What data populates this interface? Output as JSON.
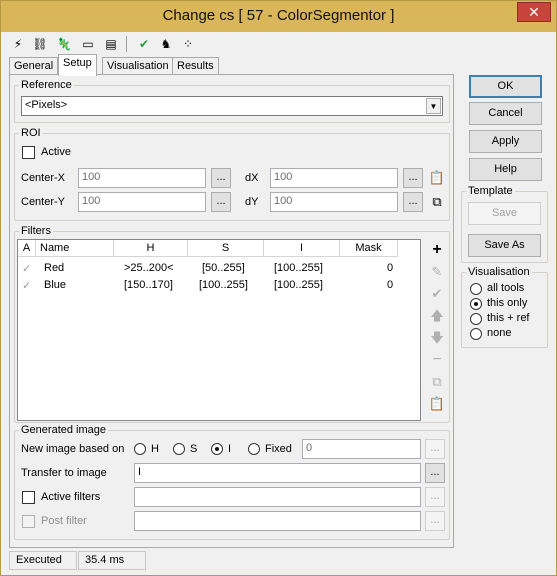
{
  "window": {
    "title": "Change cs [ 57 - ColorSegmentor ]",
    "close_label": "✕"
  },
  "toolbar": {
    "icons": [
      "lightning-icon",
      "link-icon",
      "dinosaur-icon",
      "console-icon",
      "document-icon",
      "checkmark-icon",
      "figure-icon",
      "dots-icon"
    ]
  },
  "tabs": [
    "General",
    "Setup",
    "Visualisation",
    "Results"
  ],
  "reference": {
    "legend": "Reference",
    "value": "<Pixels>"
  },
  "roi": {
    "legend": "ROI",
    "active_label": "Active",
    "center_x_label": "Center-X",
    "center_x": "100",
    "center_y_label": "Center-Y",
    "center_y": "100",
    "dx_label": "dX",
    "dx": "100",
    "dy_label": "dY",
    "dy": "100",
    "dots": "..."
  },
  "filters": {
    "legend": "Filters",
    "columns": [
      "A",
      "Name",
      "H",
      "S",
      "I",
      "Mask"
    ],
    "rows": [
      {
        "name": "Red",
        "h": ">25..200<",
        "s": "[50..255]",
        "i": "[100..255]",
        "mask": "0"
      },
      {
        "name": "Blue",
        "h": "[150..170]",
        "s": "[100..255]",
        "i": "[100..255]",
        "mask": "0"
      }
    ]
  },
  "generated": {
    "legend": "Generated image",
    "new_image_label": "New image based on",
    "radio_h": "H",
    "radio_s": "S",
    "radio_i": "I",
    "radio_fixed": "Fixed",
    "fixed_value": "0",
    "transfer_label": "Transfer to image",
    "transfer_value": "I",
    "active_filters_label": "Active filters",
    "post_filter_label": "Post filter"
  },
  "buttons": {
    "ok": "OK",
    "cancel": "Cancel",
    "apply": "Apply",
    "help": "Help"
  },
  "template": {
    "legend": "Template",
    "save": "Save",
    "save_as": "Save As"
  },
  "visualisation": {
    "legend": "Visualisation",
    "options": [
      "all tools",
      "this only",
      "this + ref",
      "none"
    ],
    "selected": "this only"
  },
  "status": {
    "state": "Executed",
    "time": "35.4 ms"
  }
}
